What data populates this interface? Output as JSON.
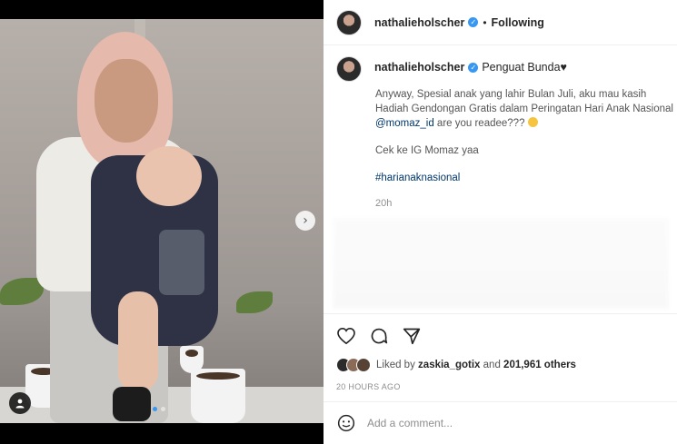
{
  "post_header": {
    "username": "nathalieholscher",
    "separator": "•",
    "follow_status": "Following"
  },
  "caption": {
    "username": "nathalieholscher",
    "status": "Penguat Bunda♥",
    "line1_prefix": "Anyway, Spesial anak yang lahir Bulan Juli, aku mau kasih Hadiah Gendongan Gratis dalam Peringatan Hari Anak Nasional ",
    "mention": "@momaz_id",
    "line1_suffix": " are you readee???",
    "line2": "Cek ke IG Momaz yaa",
    "hashtag": "#harianaknasional",
    "time": "20h"
  },
  "likes": {
    "prefix": "Liked by",
    "user": "zaskia_gotix",
    "connector": "and",
    "count": "201,961 others"
  },
  "timestamp": "20 HOURS AGO",
  "comment_input": {
    "placeholder": "Add a comment..."
  },
  "carousel": {
    "total_slides": 2,
    "active_index": 0
  },
  "icons": {
    "verified": "verified-badge-icon",
    "like": "heart-icon",
    "comment": "comment-bubble-icon",
    "share": "paper-plane-icon",
    "emoji": "smiley-icon",
    "next": "chevron-right-icon",
    "tagged": "user-tag-icon"
  },
  "colors": {
    "link": "#00376b",
    "verified": "#3897f0",
    "muted": "#8e8e8e"
  }
}
